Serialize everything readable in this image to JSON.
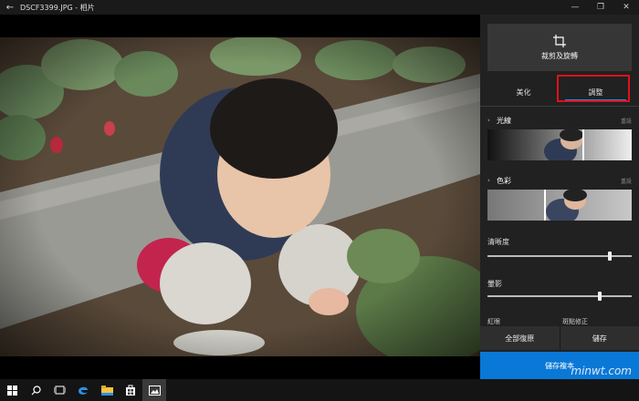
{
  "window": {
    "back_icon": "back-arrow-icon",
    "title": "DSCF3399.JPG - 相片",
    "controls": [
      "minimize-icon",
      "restore-icon",
      "close-icon"
    ]
  },
  "photo": {
    "description_icon": "photo-image"
  },
  "panel": {
    "crop_label": "裁剪及旋轉",
    "tabs": [
      {
        "label": "美化",
        "active": false
      },
      {
        "label": "調整",
        "active": true
      }
    ],
    "sections": [
      {
        "label": "光線",
        "reset": "重設"
      },
      {
        "label": "色彩",
        "reset": "重設"
      }
    ],
    "sliders": [
      {
        "label": "清晰度",
        "value": 0.85
      },
      {
        "label": "暈影",
        "value": 0.78
      }
    ],
    "cut_labels": [
      "紅眼",
      "斑點修正"
    ],
    "buttons": {
      "restore_all": "全部復原",
      "save": "儲存",
      "save_copy": "儲存複本"
    }
  },
  "watermark": "minwt.com",
  "accent_color": "#0a78d7",
  "highlight_color": "#e0101a"
}
